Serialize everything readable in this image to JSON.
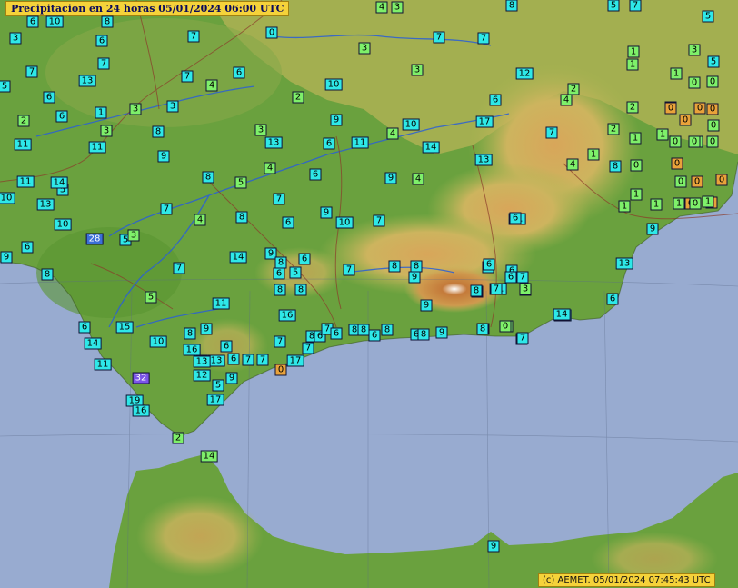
{
  "title": "Precipitacion en 24 horas    05/01/2024 06:00 UTC",
  "copyright": "(c) AEMET. 05/01/2024 07:45:43 UTC",
  "colors": {
    "sea": "#98abd0",
    "lowland": "#5c9a3a",
    "plateau": "#c9b25a",
    "mountain": "#c27840",
    "river": "#2a5fd6",
    "border": "#8b3a2a",
    "label_cyan": "#2ee8e8",
    "label_green": "#7ef06a",
    "label_orange": "#e9a23a",
    "label_violet": "#7b55e8",
    "label_blue": "#3b6fd8"
  },
  "stations": [
    {
      "v": "6",
      "c": "c"
    },
    {
      "v": "10",
      "c": "c"
    },
    {
      "v": "8",
      "c": "c"
    },
    {
      "v": "7",
      "c": "c"
    },
    {
      "v": "4",
      "c": "g"
    },
    {
      "v": "8",
      "c": "c"
    },
    {
      "v": "5",
      "c": "c"
    },
    {
      "v": "7",
      "c": "c"
    },
    {
      "v": "3",
      "c": "g"
    },
    {
      "v": "3",
      "c": "c"
    },
    {
      "v": "0",
      "c": "c"
    },
    {
      "v": "6",
      "c": "c"
    },
    {
      "v": "7",
      "c": "c"
    },
    {
      "v": "3",
      "c": "g"
    },
    {
      "v": "7",
      "c": "c"
    },
    {
      "v": "12",
      "c": "c"
    },
    {
      "v": "3",
      "c": "g"
    },
    {
      "v": "7",
      "c": "c"
    },
    {
      "v": "7",
      "c": "c"
    },
    {
      "v": "13",
      "c": "c"
    },
    {
      "v": "7",
      "c": "c"
    },
    {
      "v": "6",
      "c": "c"
    },
    {
      "v": "4",
      "c": "g"
    },
    {
      "v": "3",
      "c": "g"
    },
    {
      "v": "3",
      "c": "c"
    },
    {
      "v": "2",
      "c": "g"
    },
    {
      "v": "10",
      "c": "c"
    },
    {
      "v": "5",
      "c": "c"
    },
    {
      "v": "6",
      "c": "c"
    },
    {
      "v": "6",
      "c": "c"
    },
    {
      "v": "1",
      "c": "c"
    },
    {
      "v": "3",
      "c": "g"
    },
    {
      "v": "3",
      "c": "g"
    },
    {
      "v": "9",
      "c": "c"
    },
    {
      "v": "11",
      "c": "c"
    },
    {
      "v": "17",
      "c": "c"
    },
    {
      "v": "8",
      "c": "c"
    },
    {
      "v": "6",
      "c": "c"
    },
    {
      "v": "2",
      "c": "g"
    },
    {
      "v": "10",
      "c": "c"
    },
    {
      "v": "4",
      "c": "g"
    },
    {
      "v": "11",
      "c": "c"
    },
    {
      "v": "11",
      "c": "c"
    },
    {
      "v": "13",
      "c": "c"
    },
    {
      "v": "6",
      "c": "c"
    },
    {
      "v": "9",
      "c": "c"
    },
    {
      "v": "14",
      "c": "c"
    },
    {
      "v": "13",
      "c": "c"
    },
    {
      "v": "9",
      "c": "c"
    },
    {
      "v": "4",
      "c": "g"
    },
    {
      "v": "4",
      "c": "g"
    },
    {
      "v": "6",
      "c": "c"
    },
    {
      "v": "8",
      "c": "c"
    },
    {
      "v": "11",
      "c": "c"
    },
    {
      "v": "10",
      "c": "c"
    },
    {
      "v": "5",
      "c": "c"
    },
    {
      "v": "14",
      "c": "c"
    },
    {
      "v": "13",
      "c": "c"
    },
    {
      "v": "5",
      "c": "g"
    },
    {
      "v": "7",
      "c": "c"
    },
    {
      "v": "7",
      "c": "c"
    },
    {
      "v": "4",
      "c": "g"
    },
    {
      "v": "8",
      "c": "c"
    },
    {
      "v": "6",
      "c": "c"
    },
    {
      "v": "9",
      "c": "c"
    },
    {
      "v": "10",
      "c": "c"
    },
    {
      "v": "7",
      "c": "c"
    },
    {
      "v": "11",
      "c": "c"
    },
    {
      "v": "5",
      "c": "c"
    },
    {
      "v": "10",
      "c": "c"
    },
    {
      "v": "6",
      "c": "c"
    },
    {
      "v": "28",
      "c": "b"
    },
    {
      "v": "3",
      "c": "g"
    },
    {
      "v": "9",
      "c": "c"
    },
    {
      "v": "8",
      "c": "c"
    },
    {
      "v": "7",
      "c": "c"
    },
    {
      "v": "14",
      "c": "c"
    },
    {
      "v": "9",
      "c": "c"
    },
    {
      "v": "8",
      "c": "c"
    },
    {
      "v": "6",
      "c": "c"
    },
    {
      "v": "5",
      "c": "c"
    },
    {
      "v": "6",
      "c": "c"
    },
    {
      "v": "7",
      "c": "c"
    },
    {
      "v": "8",
      "c": "c"
    },
    {
      "v": "8",
      "c": "c"
    },
    {
      "v": "9",
      "c": "c"
    },
    {
      "v": "8",
      "c": "c"
    },
    {
      "v": "8",
      "c": "c"
    },
    {
      "v": "8",
      "c": "c"
    },
    {
      "v": "6",
      "c": "c"
    },
    {
      "v": "7",
      "c": "c"
    },
    {
      "v": "3",
      "c": "g"
    },
    {
      "v": "5",
      "c": "g"
    },
    {
      "v": "11",
      "c": "c"
    },
    {
      "v": "9",
      "c": "c"
    },
    {
      "v": "8",
      "c": "c"
    },
    {
      "v": "11",
      "c": "c"
    },
    {
      "v": "6",
      "c": "c"
    },
    {
      "v": "15",
      "c": "c"
    },
    {
      "v": "9",
      "c": "c"
    },
    {
      "v": "16",
      "c": "c"
    },
    {
      "v": "14",
      "c": "c"
    },
    {
      "v": "10",
      "c": "c"
    },
    {
      "v": "8",
      "c": "c"
    },
    {
      "v": "16",
      "c": "c"
    },
    {
      "v": "6",
      "c": "c"
    },
    {
      "v": "7",
      "c": "c"
    },
    {
      "v": "8",
      "c": "c"
    },
    {
      "v": "6",
      "c": "c"
    },
    {
      "v": "7",
      "c": "c"
    },
    {
      "v": "6",
      "c": "c"
    },
    {
      "v": "8",
      "c": "c"
    },
    {
      "v": "8",
      "c": "c"
    },
    {
      "v": "6",
      "c": "c"
    },
    {
      "v": "8",
      "c": "c"
    },
    {
      "v": "6",
      "c": "c"
    },
    {
      "v": "8",
      "c": "c"
    },
    {
      "v": "9",
      "c": "c"
    },
    {
      "v": "8",
      "c": "c"
    },
    {
      "v": "0",
      "c": "g"
    },
    {
      "v": "14",
      "c": "c"
    },
    {
      "v": "7",
      "c": "c"
    },
    {
      "v": "11",
      "c": "c"
    },
    {
      "v": "11",
      "c": "c"
    },
    {
      "v": "13",
      "c": "c"
    },
    {
      "v": "13",
      "c": "c"
    },
    {
      "v": "6",
      "c": "c"
    },
    {
      "v": "7",
      "c": "c"
    },
    {
      "v": "7",
      "c": "c"
    },
    {
      "v": "7",
      "c": "c"
    },
    {
      "v": "17",
      "c": "c"
    },
    {
      "v": "0",
      "c": "o"
    },
    {
      "v": "32",
      "c": "p"
    },
    {
      "v": "12",
      "c": "c"
    },
    {
      "v": "9",
      "c": "c"
    },
    {
      "v": "5",
      "c": "c"
    },
    {
      "v": "17",
      "c": "c"
    },
    {
      "v": "19",
      "c": "c"
    },
    {
      "v": "16",
      "c": "c"
    },
    {
      "v": "2",
      "c": "g"
    },
    {
      "v": "14",
      "c": "g"
    },
    {
      "v": "9",
      "c": "c"
    },
    {
      "v": "5",
      "c": "c"
    },
    {
      "v": "5",
      "c": "c"
    },
    {
      "v": "3",
      "c": "g"
    },
    {
      "v": "1",
      "c": "g"
    },
    {
      "v": "1",
      "c": "g"
    },
    {
      "v": "0",
      "c": "g"
    },
    {
      "v": "1",
      "c": "g"
    },
    {
      "v": "0",
      "c": "g"
    },
    {
      "v": "0",
      "c": "g"
    },
    {
      "v": "2",
      "c": "g"
    },
    {
      "v": "4",
      "c": "g"
    },
    {
      "v": "2",
      "c": "g"
    },
    {
      "v": "0",
      "c": "o"
    },
    {
      "v": "0",
      "c": "o"
    },
    {
      "v": "0",
      "c": "o"
    },
    {
      "v": "0",
      "c": "o"
    },
    {
      "v": "0",
      "c": "g"
    },
    {
      "v": "2",
      "c": "g"
    },
    {
      "v": "1",
      "c": "g"
    },
    {
      "v": "0",
      "c": "g"
    },
    {
      "v": "0",
      "c": "g"
    },
    {
      "v": "0",
      "c": "g"
    },
    {
      "v": "0",
      "c": "g"
    },
    {
      "v": "1",
      "c": "g"
    },
    {
      "v": "1",
      "c": "g"
    },
    {
      "v": "4",
      "c": "g"
    },
    {
      "v": "0",
      "c": "o"
    },
    {
      "v": "0",
      "c": "g"
    },
    {
      "v": "0",
      "c": "g"
    },
    {
      "v": "0",
      "c": "o"
    },
    {
      "v": "0",
      "c": "o"
    },
    {
      "v": "0",
      "c": "o"
    },
    {
      "v": "0",
      "c": "o"
    },
    {
      "v": "1",
      "c": "g"
    },
    {
      "v": "1",
      "c": "g"
    },
    {
      "v": "1",
      "c": "g"
    },
    {
      "v": "1",
      "c": "g"
    },
    {
      "v": "1",
      "c": "g"
    },
    {
      "v": "0",
      "c": "g"
    },
    {
      "v": "6",
      "c": "c"
    },
    {
      "v": "14",
      "c": "c"
    },
    {
      "v": "7",
      "c": "c"
    },
    {
      "v": "6",
      "c": "c"
    },
    {
      "v": "8",
      "c": "c"
    },
    {
      "v": "8",
      "c": "c"
    },
    {
      "v": "7",
      "c": "c"
    },
    {
      "v": "6",
      "c": "c"
    },
    {
      "v": "3",
      "c": "g"
    },
    {
      "v": "0",
      "c": "g"
    },
    {
      "v": "6",
      "c": "c"
    },
    {
      "v": "7",
      "c": "c"
    },
    {
      "v": "8",
      "c": "c"
    },
    {
      "v": "9",
      "c": "c"
    },
    {
      "v": "13",
      "c": "c"
    }
  ]
}
